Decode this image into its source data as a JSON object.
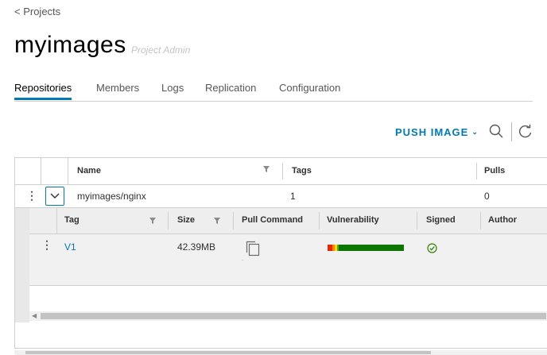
{
  "nav": {
    "back_label": "< Projects"
  },
  "project": {
    "name": "myimages",
    "role": "Project Admin"
  },
  "tabs": [
    {
      "label": "Repositories",
      "active": true
    },
    {
      "label": "Members",
      "active": false
    },
    {
      "label": "Logs",
      "active": false
    },
    {
      "label": "Replication",
      "active": false
    },
    {
      "label": "Configuration",
      "active": false
    }
  ],
  "toolbar": {
    "push_label": "PUSH IMAGE",
    "icons": [
      "search-icon",
      "refresh-icon"
    ]
  },
  "repo_table": {
    "columns": {
      "name": "Name",
      "tags": "Tags",
      "pulls": "Pulls"
    },
    "rows": [
      {
        "name": "myimages/nginx",
        "tags": "1",
        "pulls": "0"
      }
    ]
  },
  "tag_table": {
    "columns": {
      "tag": "Tag",
      "size": "Size",
      "pull_command": "Pull Command",
      "vulnerability": "Vulnerability",
      "signed": "Signed",
      "author": "Author"
    },
    "rows": [
      {
        "tag": "V1",
        "size": "42.39MB",
        "pull_command_icon": "copy-icon",
        "vulnerability": {
          "segments": [
            {
              "color": "#e62700",
              "fraction": 0.06
            },
            {
              "color": "#ff8400",
              "fraction": 0.03
            },
            {
              "color": "#ffdc0b",
              "fraction": 0.04
            },
            {
              "color": "#62a420",
              "fraction": 0.02
            },
            {
              "color": "#0b7700",
              "fraction": 0.85
            }
          ]
        },
        "signed_icon": "check-circle-icon"
      }
    ]
  },
  "colors": {
    "accent": "#0079b8",
    "text": "#313131",
    "muted": "#565656"
  }
}
